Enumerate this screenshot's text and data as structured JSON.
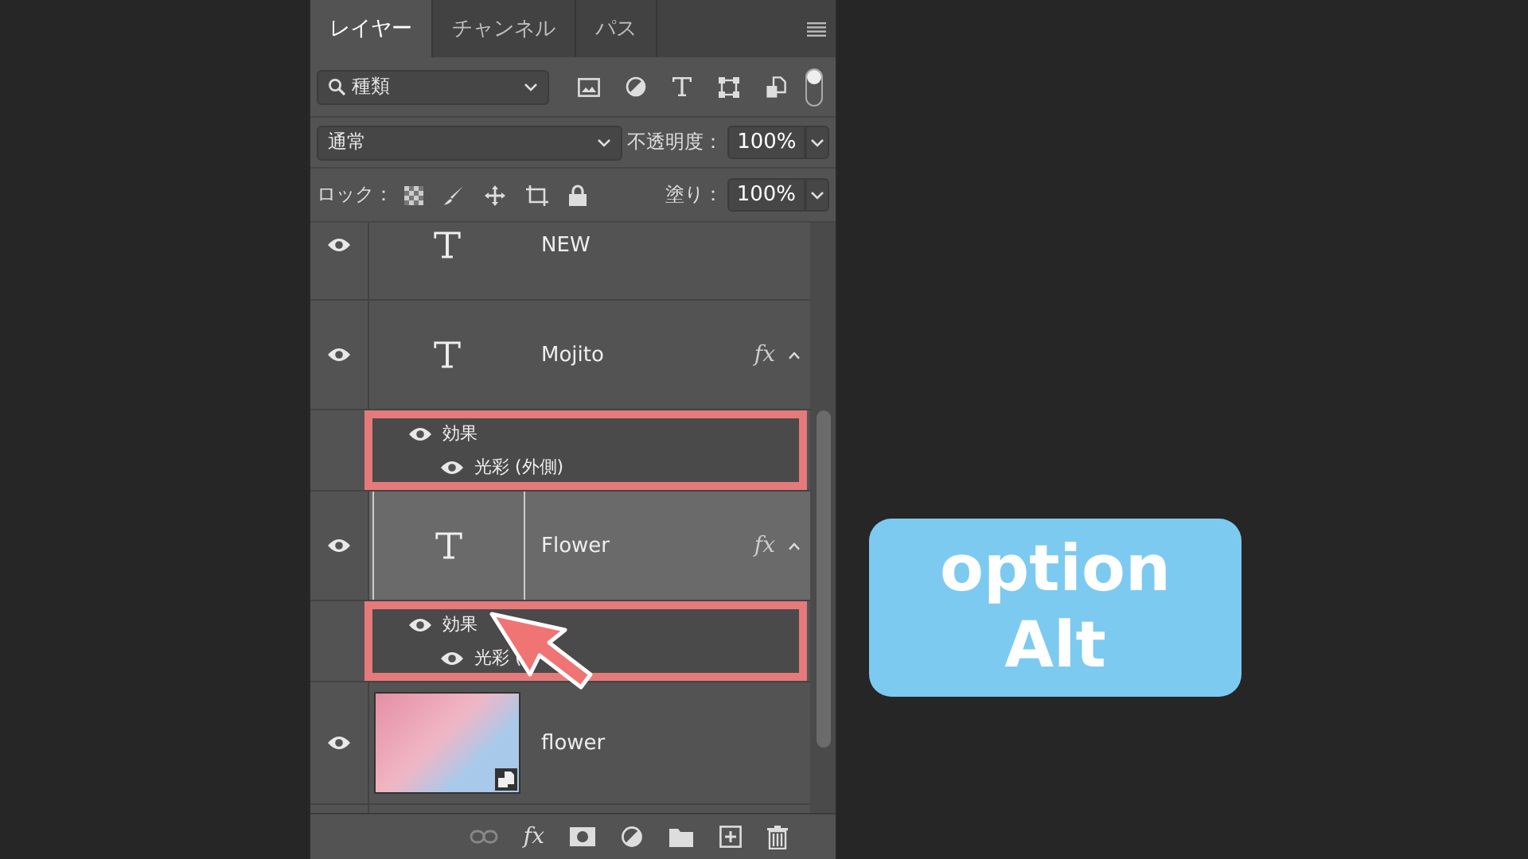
{
  "tabs": [
    {
      "label": "レイヤー",
      "selected": true
    },
    {
      "label": "チャンネル",
      "selected": false
    },
    {
      "label": "パス",
      "selected": false
    }
  ],
  "filter": {
    "value": "種類",
    "toggle_on": true
  },
  "blend": {
    "value": "通常",
    "opacity_label": "不透明度：",
    "opacity": "100%"
  },
  "lock": {
    "label": "ロック：",
    "fill_label": "塗り：",
    "fill": "100%"
  },
  "layers": [
    {
      "kind": "text",
      "name": "NEW",
      "visible": true,
      "selected": false
    },
    {
      "kind": "text",
      "name": "Mojito",
      "visible": true,
      "selected": false,
      "fx": "fx",
      "effects": {
        "highlight": true,
        "items": [
          {
            "label": "効果",
            "visible": true
          },
          {
            "label": "光彩 (外側)",
            "visible": true
          }
        ]
      }
    },
    {
      "kind": "text",
      "name": "Flower",
      "visible": true,
      "selected": true,
      "fx": "fx",
      "effects": {
        "highlight": true,
        "pointer": true,
        "items": [
          {
            "label": "効果",
            "visible": true
          },
          {
            "label": "光彩 (",
            "visible": true
          }
        ]
      }
    },
    {
      "kind": "image",
      "name": "flower",
      "visible": true,
      "selected": false
    },
    {
      "kind": "blank",
      "selected": false
    }
  ],
  "bottom_fx": "fx",
  "callout": {
    "lines": [
      "option",
      "Alt"
    ]
  }
}
